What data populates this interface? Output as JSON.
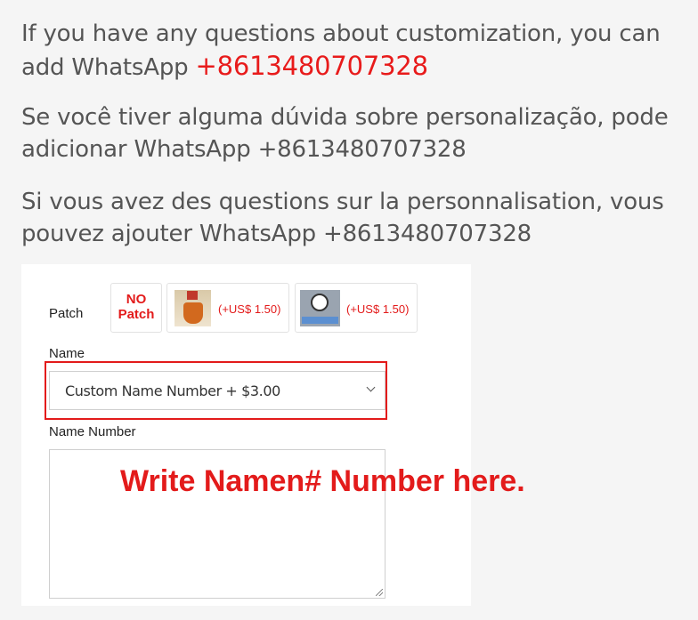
{
  "paragraphs": {
    "en_text": "If you have any questions about customization, you can add WhatsApp ",
    "en_phone": "+8613480707328",
    "pt": "Se você tiver alguma dúvida sobre personalização, pode adicionar WhatsApp +8613480707328",
    "fr": "Si vous avez des questions sur la personnalisation, vous pouvez ajouter WhatsApp +8613480707328"
  },
  "form": {
    "patch_label": "Patch",
    "patch_options": [
      {
        "line1": "NO",
        "line2": "Patch",
        "icon": "no-patch-icon"
      },
      {
        "price": "(+US$ 1.50)",
        "icon": "league-patch-icon"
      },
      {
        "price": "(+US$ 1.50)",
        "icon": "champions-ball-patch-icon"
      }
    ],
    "name_label": "Name",
    "name_select_value": "Custom Name Number + $3.00",
    "name_number_label": "Name Number"
  },
  "overlay": {
    "instruction": "Write Namen# Number here."
  },
  "colors": {
    "accent_red": "#e31b1b",
    "text_gray": "#555555"
  }
}
